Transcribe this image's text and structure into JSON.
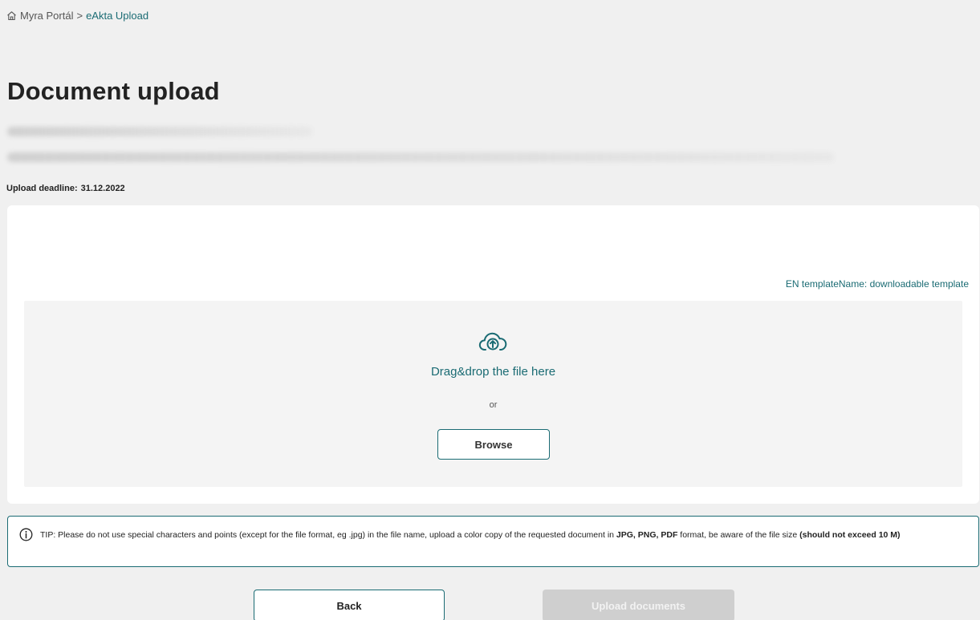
{
  "breadcrumb": {
    "home_icon": "home-icon",
    "items": [
      "Myra Portál",
      "eAkta Upload"
    ],
    "separator": ">"
  },
  "page": {
    "title": "Document upload",
    "deadline_label": "Upload deadline:",
    "deadline_value": "31.12.2022"
  },
  "card": {
    "template_link": "EN templateName: downloadable template",
    "dropzone": {
      "icon": "cloud-upload-icon",
      "drop_text": "Drag&drop the file here",
      "or_text": "or",
      "browse_label": "Browse"
    }
  },
  "tip": {
    "icon": "info-icon",
    "text_part1": "TIP: Please do not use special characters and points (except for the file format, eg .jpg) in the file name, upload a color copy of the requested document in ",
    "formats": "JPG, PNG, PDF",
    "text_part2": " format, be aware of the file size ",
    "size_note": "(should not exceed 10 M)"
  },
  "actions": {
    "back_label": "Back",
    "upload_label": "Upload documents"
  },
  "colors": {
    "accent": "#1a6b73",
    "background": "#f0f0f0",
    "disabled_button": "#cfcfcf"
  }
}
